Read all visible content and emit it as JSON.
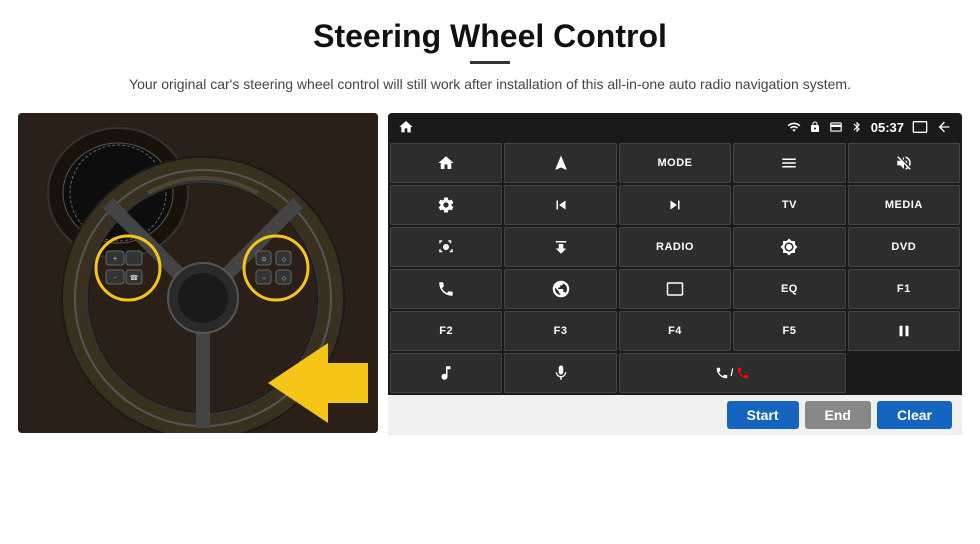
{
  "header": {
    "title": "Steering Wheel Control",
    "subtitle": "Your original car's steering wheel control will still work after installation of this all-in-one auto radio navigation system."
  },
  "status_bar": {
    "time": "05:37"
  },
  "buttons": [
    {
      "id": "home",
      "type": "icon",
      "icon": "home"
    },
    {
      "id": "nav",
      "type": "icon",
      "icon": "nav-arrow"
    },
    {
      "id": "mode",
      "type": "text",
      "label": "MODE"
    },
    {
      "id": "menu",
      "type": "icon",
      "icon": "menu"
    },
    {
      "id": "mute",
      "type": "icon",
      "icon": "mute"
    },
    {
      "id": "apps",
      "type": "icon",
      "icon": "apps"
    },
    {
      "id": "settings",
      "type": "icon",
      "icon": "settings"
    },
    {
      "id": "prev",
      "type": "icon",
      "icon": "prev"
    },
    {
      "id": "next",
      "type": "icon",
      "icon": "next"
    },
    {
      "id": "tv",
      "type": "text",
      "label": "TV"
    },
    {
      "id": "media",
      "type": "text",
      "label": "MEDIA"
    },
    {
      "id": "cam360",
      "type": "icon",
      "icon": "cam360"
    },
    {
      "id": "eject",
      "type": "icon",
      "icon": "eject"
    },
    {
      "id": "radio",
      "type": "text",
      "label": "RADIO"
    },
    {
      "id": "brightness",
      "type": "icon",
      "icon": "brightness"
    },
    {
      "id": "dvd",
      "type": "text",
      "label": "DVD"
    },
    {
      "id": "phone",
      "type": "icon",
      "icon": "phone"
    },
    {
      "id": "browser",
      "type": "icon",
      "icon": "browser"
    },
    {
      "id": "screen",
      "type": "icon",
      "icon": "screen"
    },
    {
      "id": "eq",
      "type": "text",
      "label": "EQ"
    },
    {
      "id": "f1",
      "type": "text",
      "label": "F1"
    },
    {
      "id": "f2",
      "type": "text",
      "label": "F2"
    },
    {
      "id": "f3",
      "type": "text",
      "label": "F3"
    },
    {
      "id": "f4",
      "type": "text",
      "label": "F4"
    },
    {
      "id": "f5",
      "type": "text",
      "label": "F5"
    },
    {
      "id": "playpause",
      "type": "icon",
      "icon": "playpause"
    },
    {
      "id": "music",
      "type": "icon",
      "icon": "music"
    },
    {
      "id": "mic",
      "type": "icon",
      "icon": "mic"
    },
    {
      "id": "phonecall",
      "type": "icon",
      "icon": "phonecall"
    }
  ],
  "action_bar": {
    "start_label": "Start",
    "end_label": "End",
    "clear_label": "Clear"
  }
}
